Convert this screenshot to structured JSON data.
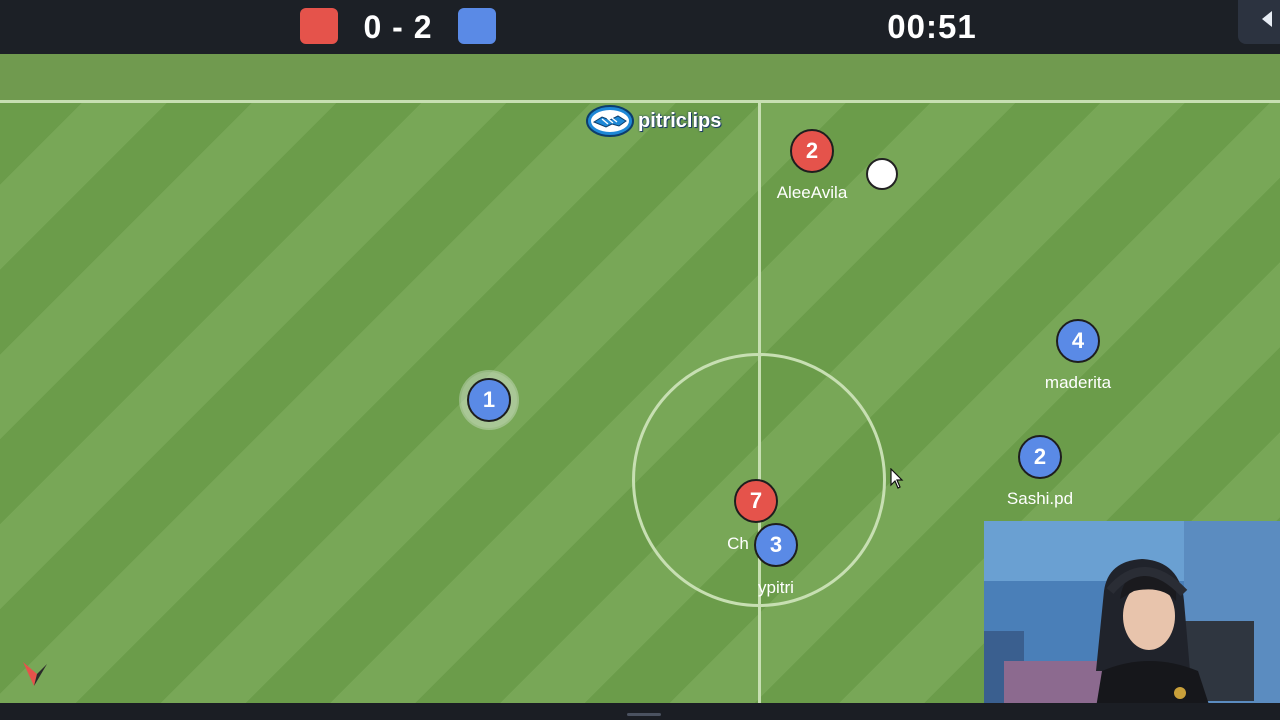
{
  "scoreboard": {
    "score": "0 - 2",
    "red_color": "#e5534b",
    "blue_color": "#5a8ae6",
    "clock": "00:51"
  },
  "overlay": {
    "brand_text": "pitriclips"
  },
  "players": [
    {
      "team": "red",
      "number": "2",
      "name": "AleeAvila"
    },
    {
      "team": "red",
      "number": "7",
      "name": "Ch"
    },
    {
      "team": "blue",
      "number": "1",
      "name": "",
      "active": true
    },
    {
      "team": "blue",
      "number": "3",
      "name": "ypitri"
    },
    {
      "team": "blue",
      "number": "4",
      "name": "maderita"
    },
    {
      "team": "blue",
      "number": "2",
      "name": "Sashi.pd"
    }
  ],
  "icons": {
    "exit": "back-arrow-icon",
    "brand": "handshake-icon",
    "cursor": "mouse-cursor-icon",
    "corner": "corner-logo-icon"
  }
}
